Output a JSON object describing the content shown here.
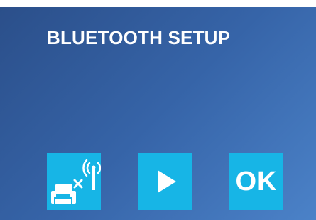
{
  "screen": {
    "title": "BLUETOOTH SETUP"
  },
  "buttons": [
    {
      "icon": "printer-bluetooth-off-icon"
    },
    {
      "icon": "play-icon"
    },
    {
      "label": "OK"
    }
  ],
  "colors": {
    "background_start": "#2b4f8a",
    "background_end": "#4b82c8",
    "tile": "#17b5e6",
    "text": "#ffffff"
  }
}
